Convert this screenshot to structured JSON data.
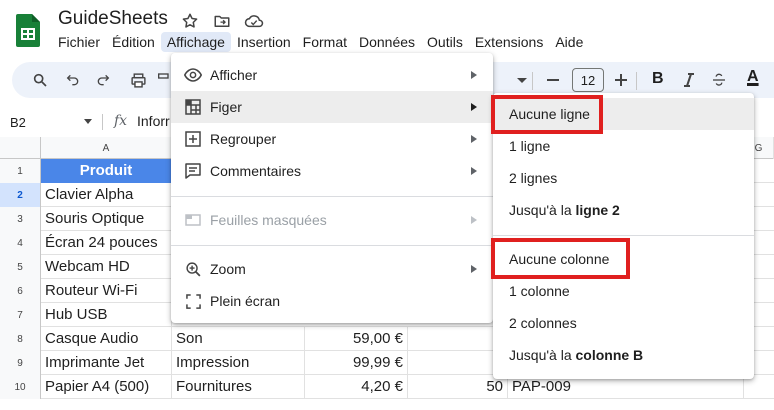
{
  "app": {
    "title": "GuideSheets",
    "accent": "#0b57d0",
    "logo_color": "#188038"
  },
  "menubar": [
    "Fichier",
    "Édition",
    "Affichage",
    "Insertion",
    "Format",
    "Données",
    "Outils",
    "Extensions",
    "Aide"
  ],
  "toolbar": {
    "font_size": "12",
    "bold": "B",
    "text_color": "A"
  },
  "formula_bar": {
    "cell_ref": "B2",
    "fx": "fx",
    "value": "Inforr"
  },
  "columns": [
    "A",
    "",
    "",
    "",
    "",
    "G"
  ],
  "rows": [
    {
      "num": "1",
      "a": "Produit"
    },
    {
      "num": "2",
      "a": "Clavier Alpha"
    },
    {
      "num": "3",
      "a": "Souris Optique"
    },
    {
      "num": "4",
      "a": "Écran 24 pouces"
    },
    {
      "num": "5",
      "a": "Webcam HD"
    },
    {
      "num": "6",
      "a": "Routeur Wi-Fi"
    },
    {
      "num": "7",
      "a": "Hub USB"
    },
    {
      "num": "8",
      "a": "Casque Audio",
      "b": "Son",
      "c": "59,00 €",
      "d": "",
      "e": ""
    },
    {
      "num": "9",
      "a": "Imprimante Jet",
      "b": "Impression",
      "c": "99,99 €",
      "d": "",
      "e": ""
    },
    {
      "num": "10",
      "a": "Papier A4 (500)",
      "b": "Fournitures",
      "c": "4,20 €",
      "d": "50",
      "e": "PAP-009"
    }
  ],
  "view_menu": {
    "items": [
      {
        "label": "Afficher",
        "icon": "eye-icon",
        "submenu": true
      },
      {
        "label": "Figer",
        "icon": "freeze-grid-icon",
        "submenu": true,
        "highlighted": true
      },
      {
        "label": "Regrouper",
        "icon": "plus-box-icon",
        "submenu": true
      },
      {
        "label": "Commentaires",
        "icon": "comment-icon",
        "submenu": true
      },
      {
        "label": "Feuilles masquées",
        "icon": "hidden-sheet-icon",
        "submenu": true,
        "disabled": true
      },
      {
        "label": "Zoom",
        "icon": "zoom-icon",
        "submenu": true
      },
      {
        "label": "Plein écran",
        "icon": "fullscreen-icon",
        "submenu": false
      }
    ]
  },
  "freeze_menu": {
    "rows": {
      "none": "Aucune ligne",
      "one": "1 ligne",
      "two": "2 lignes",
      "up_to_prefix": "Jusqu'à la ",
      "up_to_bold": "ligne 2"
    },
    "columns": {
      "none": "Aucune colonne",
      "one": "1 colonne",
      "two": "2 colonnes",
      "up_to_prefix": "Jusqu'à la ",
      "up_to_bold": "colonne B"
    }
  },
  "highlight_color": "#e0201f"
}
